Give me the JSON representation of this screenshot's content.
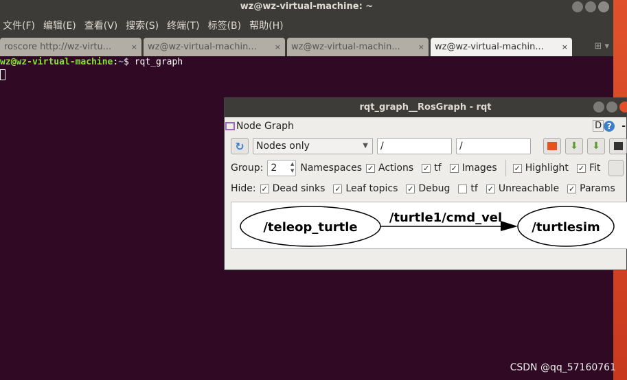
{
  "terminal": {
    "title": "wz@wz-virtual-machine: ~",
    "menu": [
      "文件(F)",
      "编辑(E)",
      "查看(V)",
      "搜索(S)",
      "终端(T)",
      "标签(B)",
      "帮助(H)"
    ],
    "tabs": [
      {
        "label": "roscore http://wz-virtu...",
        "active": false
      },
      {
        "label": "wz@wz-virtual-machin...",
        "active": false
      },
      {
        "label": "wz@wz-virtual-machin...",
        "active": false
      },
      {
        "label": "wz@wz-virtual-machin...",
        "active": true
      }
    ],
    "tab_close": "×",
    "prompt_user": "wz@wz-virtual-machine",
    "prompt_sep": ":",
    "prompt_path": "~",
    "prompt_end": "$ ",
    "command": "rqt_graph"
  },
  "rqt": {
    "title": "rqt_graph__RosGraph - rqt",
    "plugin_title": "Node Graph",
    "d_label": "D",
    "help_label": "?",
    "dash": "-",
    "mode": "Nodes only",
    "ns_filter": "/",
    "topic_filter": "/",
    "group_label": "Group:",
    "group_value": "2",
    "namespaces": "Namespaces",
    "row2": [
      {
        "label": "Actions",
        "checked": true
      },
      {
        "label": "tf",
        "checked": true
      },
      {
        "label": "Images",
        "checked": true
      },
      {
        "label": "Highlight",
        "checked": true
      },
      {
        "label": "Fit",
        "checked": true
      }
    ],
    "hide_label": "Hide:",
    "hide": [
      {
        "label": "Dead sinks",
        "checked": true
      },
      {
        "label": "Leaf topics",
        "checked": true
      },
      {
        "label": "Debug",
        "checked": true
      },
      {
        "label": "tf",
        "checked": false
      },
      {
        "label": "Unreachable",
        "checked": true
      },
      {
        "label": "Params",
        "checked": true
      }
    ],
    "graph": {
      "nodes": [
        "/teleop_turtle",
        "/turtlesim"
      ],
      "edge": "/turtle1/cmd_vel"
    }
  },
  "watermark": "CSDN @qq_57160761"
}
